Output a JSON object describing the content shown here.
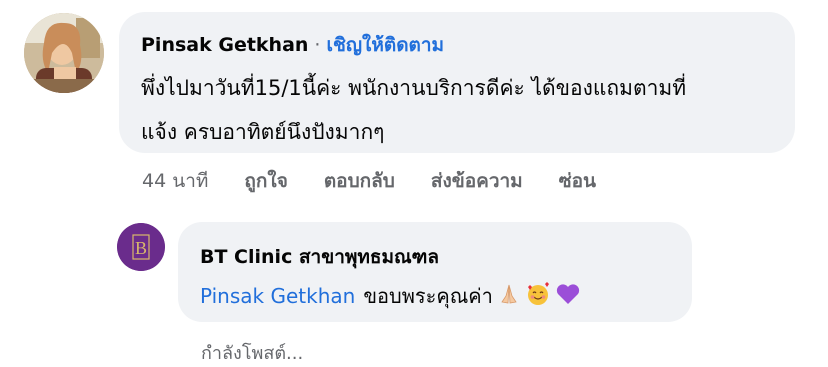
{
  "comment": {
    "author": "Pinsak Getkhan",
    "separator": "·",
    "follow_label": "เชิญให้ติดตาม",
    "text_line1": "พึ่งไปมาวันที่15/1นี้ค่ะ พนักงานบริการดีค่ะ ได้ของแถมตามที่",
    "text_line2": "แจ้ง ครบอาทิตย์นึงปังมากๆ",
    "time": "44 นาที",
    "like_label": "ถูกใจ",
    "reply_label": "ตอบกลับ",
    "message_label": "ส่งข้อความ",
    "hide_label": "ซ่อน"
  },
  "reply": {
    "author": "BT Clinic สาขาพุทธมณฑล",
    "mention": "Pinsak Getkhan",
    "text": "ขอบพระคุณค่า",
    "emojis": [
      "folded-hands-icon",
      "smiling-face-with-hearts-icon",
      "purple-heart-icon"
    ],
    "avatar_letter": "B"
  },
  "status": {
    "posting": "กำลังโพสต์..."
  },
  "colors": {
    "bubble": "#f0f2f5",
    "link": "#216fdb",
    "secondary_text": "#65676b",
    "clinic_purple": "#6a2c8c"
  }
}
